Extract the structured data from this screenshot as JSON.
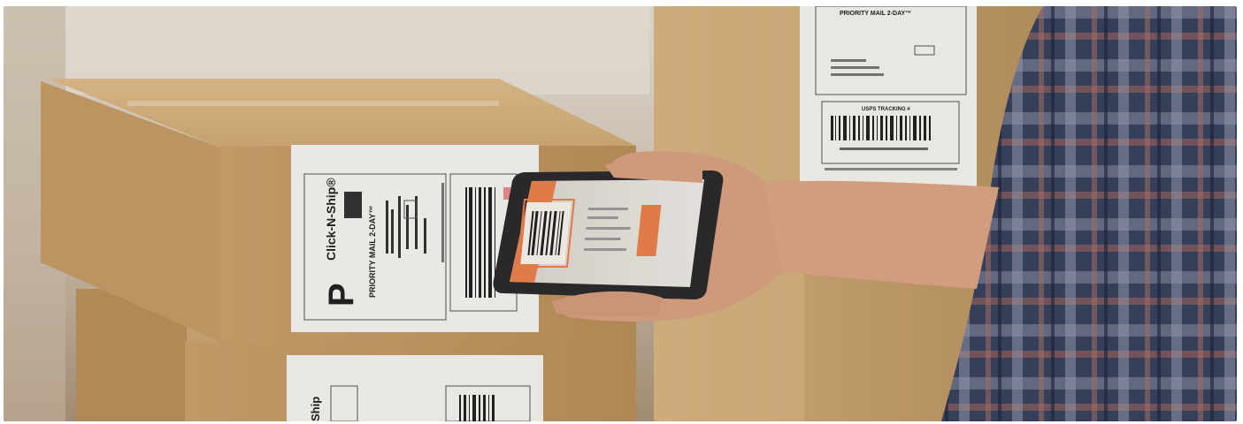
{
  "scene": {
    "description_alt": "",
    "box_top_label": {
      "service": "PRIORITY MAIL 2-DAY™",
      "brand": "Click-N-Ship®",
      "letter": "P"
    },
    "box_bottom_label": {
      "brand": "Ship"
    },
    "box_right_label": {
      "service": "PRIORITY MAIL 2-DAY™",
      "tracking_header": "USPS TRACKING #"
    }
  },
  "colors": {
    "cardboard": "#c9a06a",
    "label": "#f4f2ee",
    "phone_accent": "#e8814c",
    "shirt_navy": "#2c3550"
  }
}
